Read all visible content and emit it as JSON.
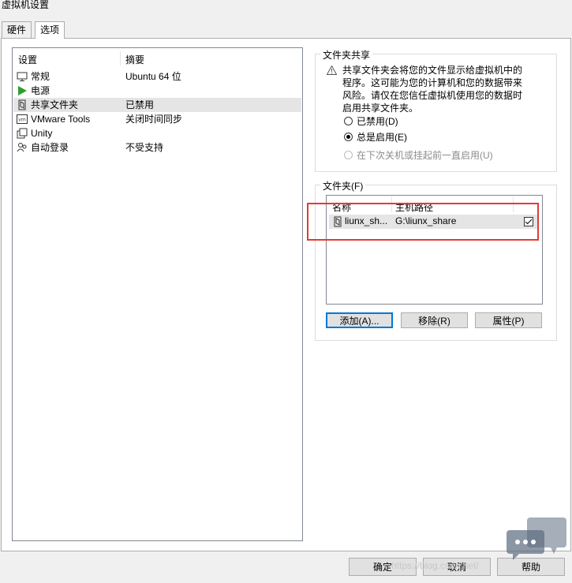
{
  "window": {
    "title": "虚拟机设置"
  },
  "tabs": [
    {
      "label": "硬件",
      "active": false
    },
    {
      "label": "选项",
      "active": true
    }
  ],
  "settings_list": {
    "headers": {
      "setting": "设置",
      "summary": "摘要"
    },
    "items": [
      {
        "name": "常规",
        "summary": "Ubuntu 64 位",
        "icon": "monitor-icon",
        "selected": false
      },
      {
        "name": "电源",
        "summary": "",
        "icon": "play-icon",
        "selected": false
      },
      {
        "name": "共享文件夹",
        "summary": "已禁用",
        "icon": "folder-share-icon",
        "selected": true
      },
      {
        "name": "VMware Tools",
        "summary": "关闭时间同步",
        "icon": "vm-icon",
        "selected": false
      },
      {
        "name": "Unity",
        "summary": "",
        "icon": "windows-icon",
        "selected": false
      },
      {
        "name": "自动登录",
        "summary": "不受支持",
        "icon": "users-icon",
        "selected": false
      }
    ]
  },
  "shared_folders": {
    "legend": "文件夹共享",
    "warning": "共享文件夹会将您的文件显示给虚拟机中的程序。这可能为您的计算机和您的数据带来风险。请仅在您信任虚拟机使用您的数据时启用共享文件夹。",
    "options": [
      {
        "label": "已禁用(D)",
        "checked": false,
        "disabled": false
      },
      {
        "label": "总是启用(E)",
        "checked": true,
        "disabled": false
      },
      {
        "label": "在下次关机或挂起前一直启用(U)",
        "checked": false,
        "disabled": true
      }
    ]
  },
  "folders": {
    "legend": "文件夹(F)",
    "headers": {
      "name": "名称",
      "host_path": "主机路径"
    },
    "rows": [
      {
        "name": "liunx_sh...",
        "host_path": "G:\\liunx_share",
        "enabled": true
      }
    ],
    "buttons": {
      "add": "添加(A)...",
      "remove": "移除(R)",
      "properties": "属性(P)"
    }
  },
  "footer": {
    "ok": "确定",
    "cancel": "取消",
    "help": "帮助"
  },
  "watermark": "https://blog.csdn.net/",
  "colors": {
    "highlight_box": "#e53935",
    "selection": "#e5e5e5",
    "play_green": "#2e9e2e"
  }
}
